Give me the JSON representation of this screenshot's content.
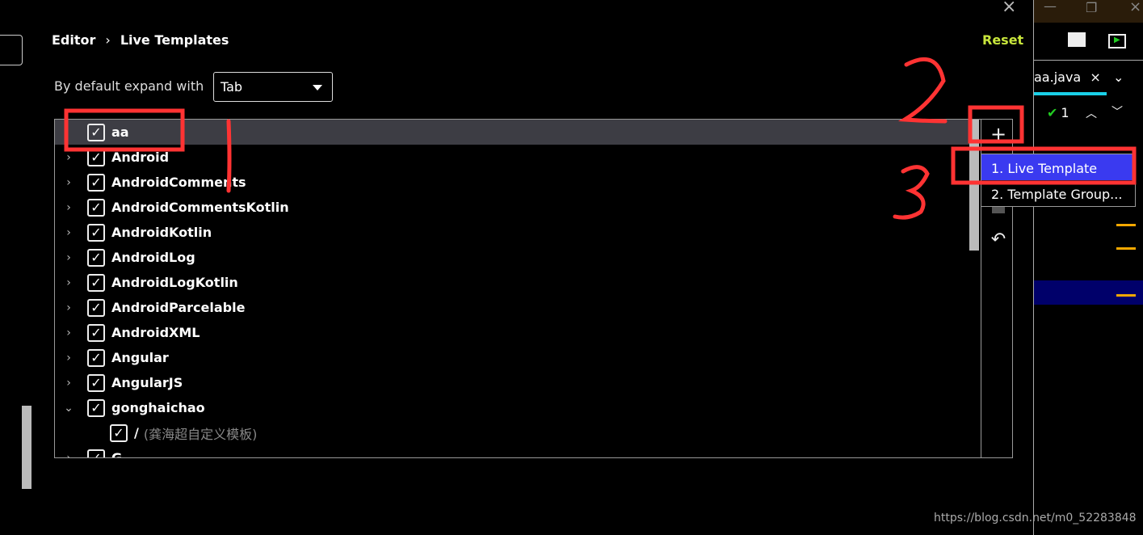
{
  "breadcrumb": {
    "parent": "Editor",
    "separator": "›",
    "current": "Live Templates"
  },
  "reset_label": "Reset",
  "close_icon": "×",
  "expand": {
    "label": "By default expand with",
    "value": "Tab"
  },
  "tree": {
    "rows": [
      {
        "label": "aa",
        "expanded": null,
        "checked": true,
        "selected": true
      },
      {
        "label": "Android",
        "expanded": false,
        "checked": true
      },
      {
        "label": "AndroidComments",
        "expanded": false,
        "checked": true
      },
      {
        "label": "AndroidCommentsKotlin",
        "expanded": false,
        "checked": true
      },
      {
        "label": "AndroidKotlin",
        "expanded": false,
        "checked": true
      },
      {
        "label": "AndroidLog",
        "expanded": false,
        "checked": true
      },
      {
        "label": "AndroidLogKotlin",
        "expanded": false,
        "checked": true
      },
      {
        "label": "AndroidParcelable",
        "expanded": false,
        "checked": true
      },
      {
        "label": "AndroidXML",
        "expanded": false,
        "checked": true
      },
      {
        "label": "Angular",
        "expanded": false,
        "checked": true
      },
      {
        "label": "AngularJS",
        "expanded": false,
        "checked": true
      },
      {
        "label": "gonghaichao",
        "expanded": true,
        "checked": true
      },
      {
        "label": "/",
        "sub": "(龚海超自定义模板)",
        "child": true,
        "checked": true
      },
      {
        "label": "G...",
        "expanded": false,
        "checked": true
      }
    ]
  },
  "toolbar": {
    "add": "+",
    "revert": "↶"
  },
  "add_menu": {
    "items": [
      "1. Live Template",
      "2. Template Group..."
    ],
    "highlighted": 0
  },
  "ide": {
    "tab": "aa.java",
    "inspection_count": "1"
  },
  "annotations": [
    "1",
    "2",
    "3"
  ],
  "watermark": "https://blog.csdn.net/m0_52283848",
  "colors": {
    "reset": "#c8e63c",
    "menu_highlight": "#3a3af0",
    "annotation": "#ff3333"
  }
}
